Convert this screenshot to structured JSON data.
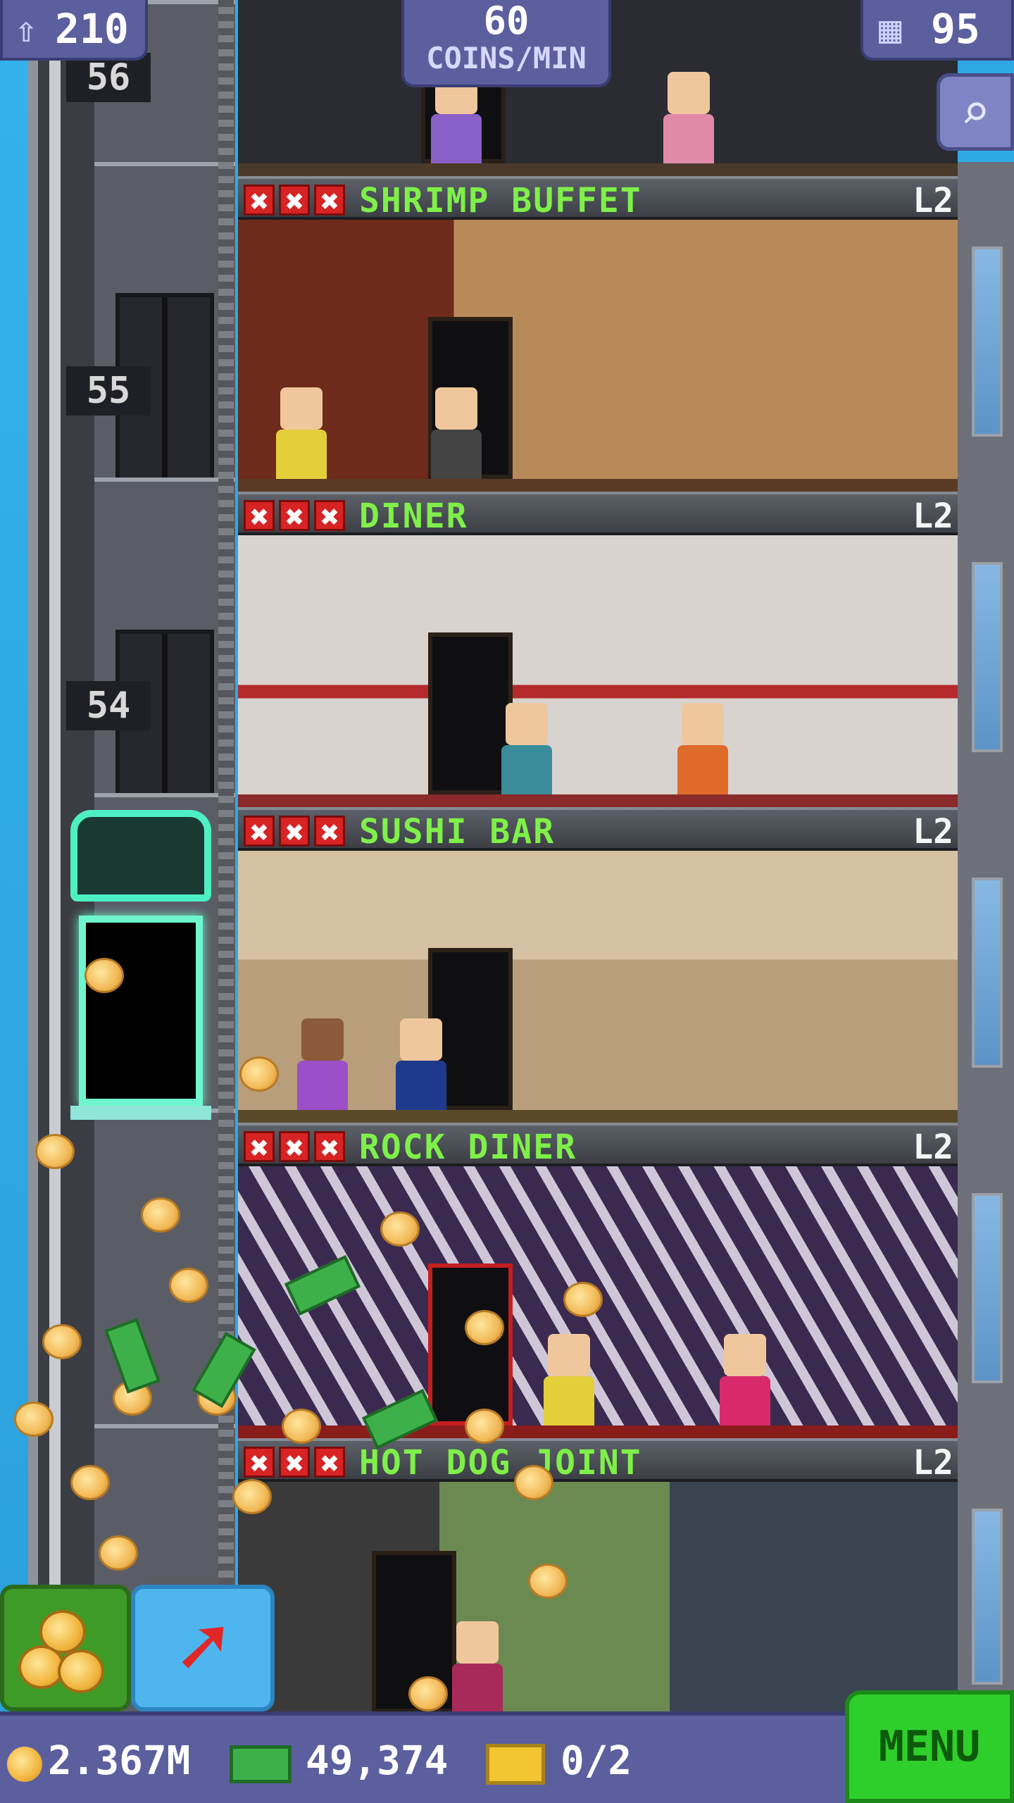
{
  "top": {
    "population": "210",
    "coins_rate": "60",
    "coins_rate_unit": "COINS/MIN",
    "floors_count": "95",
    "population_icon": "person-up-icon",
    "floors_icon": "building-icon",
    "search_icon": "magnifier-icon"
  },
  "elevator": {
    "floor_numbers": [
      "56",
      "55",
      "54"
    ]
  },
  "floors": [
    {
      "name": "SHRIMP BUFFET",
      "level": "L2",
      "stock_marks": [
        "✖",
        "✖",
        "✖"
      ],
      "wall_color": "#5a2a1c"
    },
    {
      "name": "DINER",
      "level": "L2",
      "stock_marks": [
        "✖",
        "✖",
        "✖"
      ],
      "wall_color": "#c9c4c0"
    },
    {
      "name": "SUSHI BAR",
      "level": "L2",
      "stock_marks": [
        "✖",
        "✖",
        "✖"
      ],
      "wall_color": "#d6c2a2"
    },
    {
      "name": "ROCK DINER",
      "level": "L2",
      "stock_marks": [
        "✖",
        "✖",
        "✖"
      ],
      "wall_color": "#3b2a4f"
    },
    {
      "name": "HOT DOG JOINT",
      "level": "L2",
      "stock_marks": [
        "✖",
        "✖",
        "✖"
      ],
      "wall_color": "#3c5a3a"
    }
  ],
  "bottom": {
    "coins": "2.367M",
    "bux": "49,374",
    "tickets": "0/2",
    "menu_label": "MENU",
    "coins_icon": "coin-icon",
    "bux_icon": "bux-icon",
    "tickets_icon": "ticket-icon"
  },
  "buttons": {
    "collect_icon": "coins-stack-icon",
    "rocket_icon": "rocket-icon"
  },
  "colors": {
    "hud": "#5b5f9e",
    "floor_name": "#7ff04a",
    "stock_mark": "#d72323",
    "menu": "#2fcf2b",
    "elevator_glow": "#6ef7cf"
  }
}
